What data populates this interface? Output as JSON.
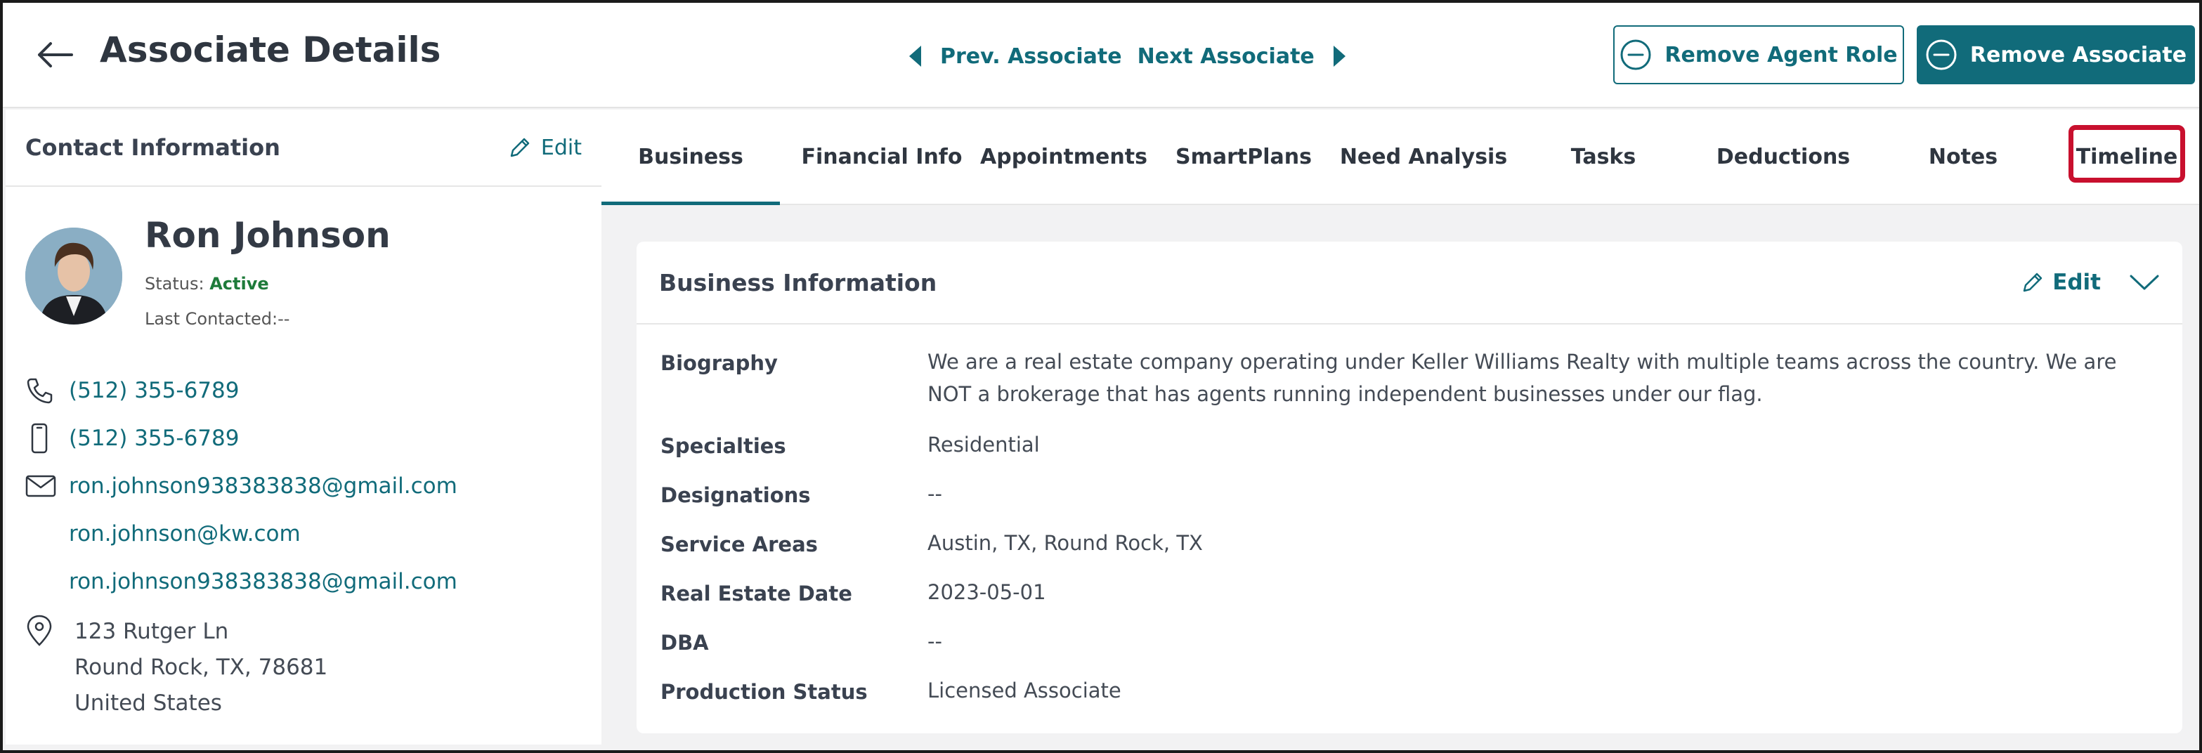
{
  "header": {
    "title": "Associate Details",
    "prev_label": "Prev. Associate",
    "next_label": "Next Associate",
    "remove_agent_role_label": "Remove Agent Role",
    "remove_associate_label": "Remove Associate"
  },
  "contact": {
    "section_title": "Contact Information",
    "edit_label": "Edit",
    "name": "Ron Johnson",
    "status_label": "Status:",
    "status_value": "Active",
    "last_contacted_label": "Last Contacted:",
    "last_contacted_value": "--",
    "phone": "(512) 355-6789",
    "mobile": "(512) 355-6789",
    "emails": [
      "ron.johnson938383838@gmail.com",
      "ron.johnson@kw.com",
      "ron.johnson938383838@gmail.com"
    ],
    "address": {
      "line1": "123 Rutger Ln",
      "line2": "Round Rock, TX, 78681",
      "line3": "United States"
    }
  },
  "tabs": [
    {
      "label": "Business"
    },
    {
      "label": "Financial Info"
    },
    {
      "label": "Appointments"
    },
    {
      "label": "SmartPlans"
    },
    {
      "label": "Need Analysis"
    },
    {
      "label": "Tasks"
    },
    {
      "label": "Deductions"
    },
    {
      "label": "Notes"
    },
    {
      "label": "Timeline"
    }
  ],
  "active_tab": "Business",
  "business": {
    "title": "Business Information",
    "edit_label": "Edit",
    "fields": [
      {
        "label": "Biography",
        "value": "We are a real estate company operating under Keller Williams Realty with multiple teams across the country. We are NOT a brokerage that has agents running independent businesses under our flag."
      },
      {
        "label": "Specialties",
        "value": "Residential"
      },
      {
        "label": "Designations",
        "value": "--"
      },
      {
        "label": "Service Areas",
        "value": "Austin, TX, Round Rock, TX"
      },
      {
        "label": "Real Estate Date",
        "value": "2023-05-01"
      },
      {
        "label": "DBA",
        "value": "--"
      },
      {
        "label": "Production Status",
        "value": "Licensed Associate"
      }
    ]
  },
  "colors": {
    "accent": "#116b7a",
    "active_status": "#1e7b3a",
    "highlight": "#c8102e"
  }
}
